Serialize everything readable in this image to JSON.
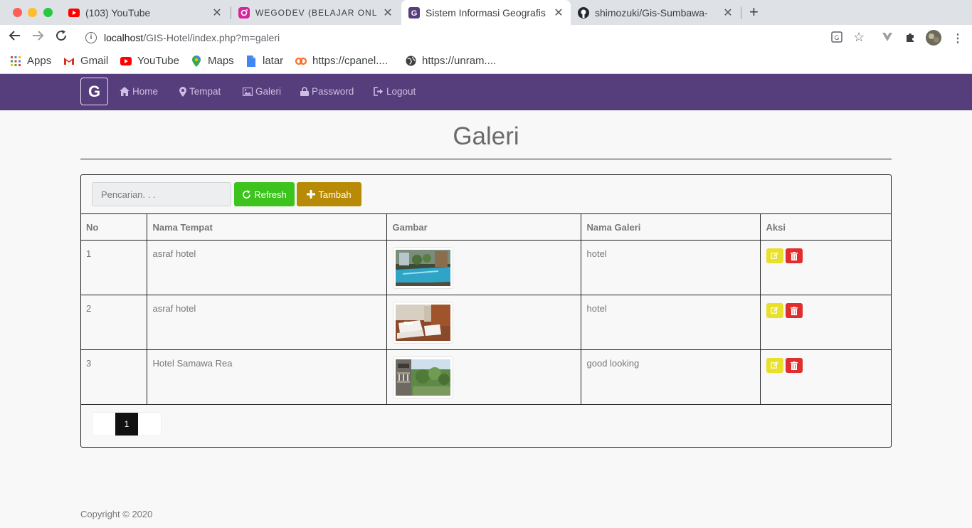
{
  "browser": {
    "tabs": [
      {
        "title": "(103) YouTube",
        "icon": "youtube-icon",
        "active": false
      },
      {
        "title": "WEGODEV (BELAJAR ONLINE",
        "icon": "instagram-icon",
        "active": false
      },
      {
        "title": "Sistem Informasi Geografis",
        "icon": "gis-favicon-icon",
        "active": true
      },
      {
        "title": "shimozuki/Gis-Sumbawa-",
        "icon": "github-icon",
        "active": false
      }
    ],
    "new_tab": "+",
    "url_host": "localhost",
    "url_path": "/GIS-Hotel/index.php?m=galeri",
    "bookmarks": [
      "Apps",
      "Gmail",
      "YouTube",
      "Maps",
      "latar",
      "https://cpanel....",
      "https://unram...."
    ]
  },
  "navbar": {
    "brand": "G",
    "links": [
      "Home",
      "Tempat",
      "Galeri",
      "Password",
      "Logout"
    ],
    "color": "#563d7c"
  },
  "page": {
    "title": "Galeri",
    "search_placeholder": "Pencarian. . .",
    "refresh_label": "Refresh",
    "add_label": "Tambah",
    "columns": [
      "No",
      "Nama Tempat",
      "Gambar",
      "Nama Galeri",
      "Aksi"
    ],
    "rows": [
      {
        "no": "1",
        "tempat": "asraf hotel",
        "galeri": "hotel",
        "image": "pool-photo"
      },
      {
        "no": "2",
        "tempat": "asraf hotel",
        "galeri": "hotel",
        "image": "bedroom-photo"
      },
      {
        "no": "3",
        "tempat": "Hotel Samawa Rea",
        "galeri": "good looking",
        "image": "balcony-garden-photo"
      }
    ],
    "pagination": [
      "1"
    ],
    "footer": "Copyright © 2020"
  },
  "colors": {
    "refresh": "#3cc31d",
    "add": "#b88b06",
    "edit": "#e8e02a",
    "delete": "#e02d2d",
    "pager_active": "#111111"
  }
}
